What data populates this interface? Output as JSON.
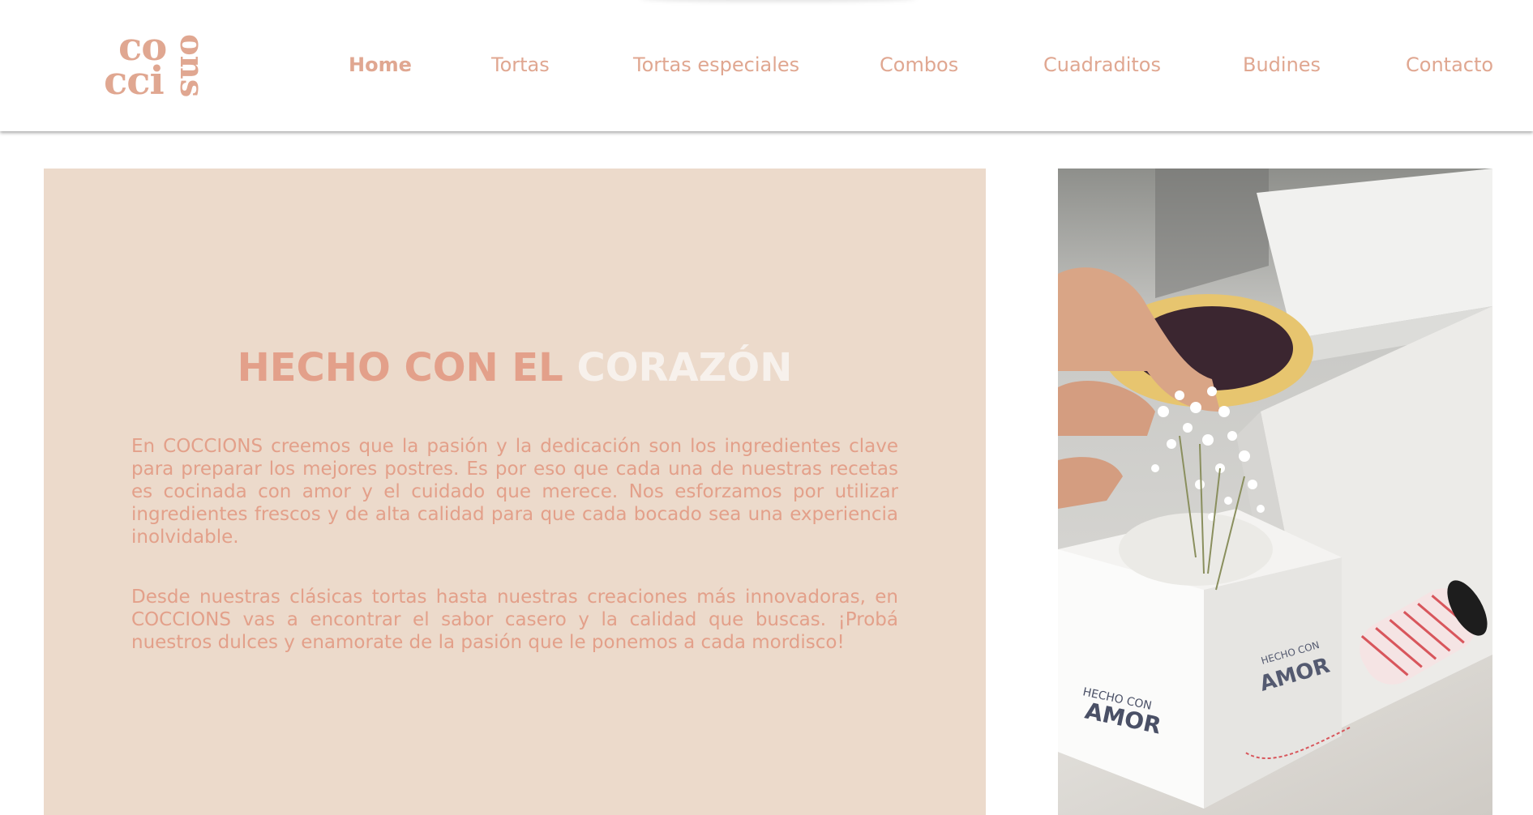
{
  "brand": {
    "logo_line1": "co",
    "logo_line2": "cci",
    "logo_vertical": "ons",
    "color": "#e0a791"
  },
  "nav": {
    "items": [
      {
        "label": "Home",
        "active": true
      },
      {
        "label": "Tortas",
        "active": false
      },
      {
        "label": "Tortas especiales",
        "active": false
      },
      {
        "label": "Combos",
        "active": false
      },
      {
        "label": "Cuadraditos",
        "active": false
      },
      {
        "label": "Budines",
        "active": false
      },
      {
        "label": "Contacto",
        "active": false
      }
    ]
  },
  "hero": {
    "title_part1": "HECHO CON EL",
    "title_part2": "CORAZÓN",
    "paragraph1": "En COCCIONS creemos que la pasión y la dedicación son los ingredientes clave para preparar los mejores postres. Es por eso que cada una de nuestras recetas es cocinada con amor y el cuidado que merece. Nos esforzamos por utilizar ingredientes frescos y de alta calidad para que cada bocado sea una experiencia inolvidable.",
    "paragraph2": "Desde nuestras clásicas tortas hasta nuestras creaciones más innovadoras, en COCCIONS vas a encontrar el sabor casero y la calidad que buscas. ¡Probá nuestros dulces y enamorate de la pasión que le ponemos a cada mordisco!",
    "panel_color": "#ecdacb",
    "accent_color": "#e3a08a"
  },
  "photo": {
    "box_text_1": "HECHO CON",
    "box_text_2": "AMOR"
  }
}
